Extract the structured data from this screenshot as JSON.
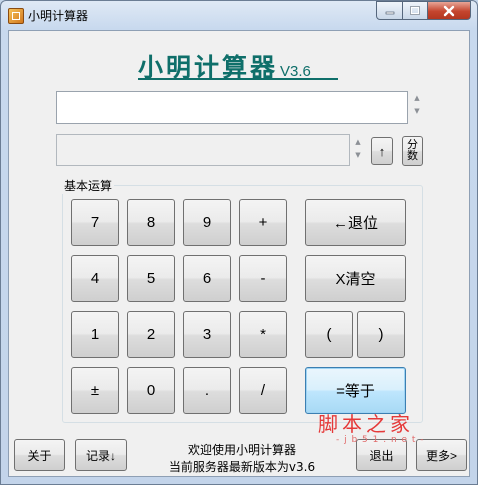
{
  "window": {
    "title": "小明计算器",
    "controls": {
      "minimize_icon": "minimize-icon",
      "maximize_icon": "maximize-icon",
      "close_icon": "close-icon"
    }
  },
  "header": {
    "brand_name": "小明计算器",
    "brand_version": "V3.6"
  },
  "display": {
    "main_value": "",
    "secondary_value": ""
  },
  "side_buttons": {
    "up_label": "↑",
    "fraction_line1": "分",
    "fraction_line2": "数"
  },
  "group": {
    "label": "基本运算",
    "keys": {
      "k7": "7",
      "k8": "8",
      "k9": "9",
      "plus": "+",
      "backspace": "←退位",
      "k4": "4",
      "k5": "5",
      "k6": "6",
      "minus": "-",
      "clear": "X清空",
      "k1": "1",
      "k2": "2",
      "k3": "3",
      "multiply": "*",
      "lparen": "(",
      "rparen": ")",
      "sign": "±",
      "k0": "0",
      "dot": ".",
      "divide": "/",
      "equals": "=等于"
    }
  },
  "footer": {
    "about_label": "关于",
    "history_label": "记录↓",
    "status_line1": "欢迎使用小明计算器",
    "status_line2": "当前服务器最新版本为v3.6",
    "exit_label": "退出",
    "more_label": "更多>"
  },
  "watermark": {
    "main": "脚本之家",
    "sub": "- j b 5 1 . n e t -"
  },
  "colors": {
    "brand": "#0f6f6a",
    "watermark": "#e53939",
    "equal_accent": "#3c7fb1"
  }
}
